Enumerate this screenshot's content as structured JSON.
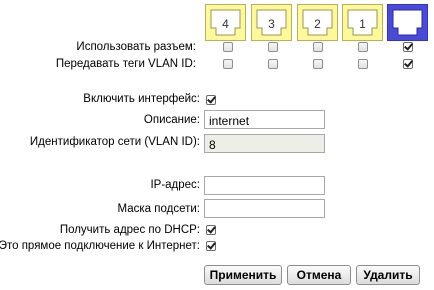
{
  "ports": [
    {
      "label": "4",
      "color": "#fdf99a"
    },
    {
      "label": "3",
      "color": "#fdf99a"
    },
    {
      "label": "2",
      "color": "#fdf99a"
    },
    {
      "label": "1",
      "color": "#fdf99a"
    },
    {
      "label": "",
      "color": "#4a4ad8"
    }
  ],
  "labels": {
    "use_port": "Использовать разъем:",
    "send_vlan_tags": "Передавать теги VLAN ID:",
    "enable_interface": "Включить интерфейс:",
    "description": "Описание:",
    "vlan_id": "Идентификатор сети (VLAN ID):",
    "ip_address": "IP-адрес:",
    "subnet_mask": "Маска подсети:",
    "dhcp": "Получить адрес по DHCP:",
    "direct_internet": "Это прямое подключение к Интернет:"
  },
  "use_port_checked": [
    false,
    false,
    false,
    false,
    true
  ],
  "send_vlan_tags_checked": [
    false,
    false,
    false,
    false,
    true
  ],
  "enable_interface_checked": true,
  "description_value": "internet",
  "vlan_id_value": "8",
  "ip_address_value": "",
  "subnet_mask_value": "",
  "dhcp_checked": true,
  "direct_internet_checked": true,
  "buttons": {
    "apply": "Применить",
    "cancel": "Отмена",
    "delete": "Удалить"
  }
}
